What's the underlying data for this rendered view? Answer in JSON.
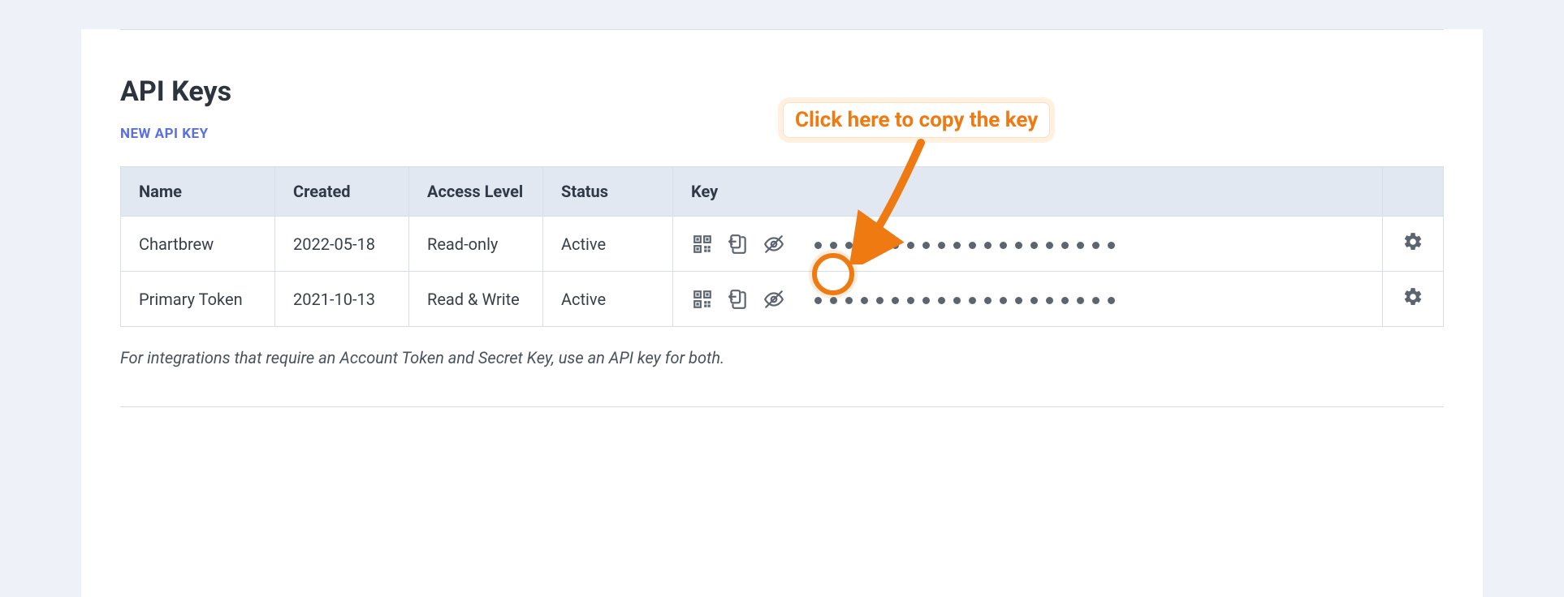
{
  "section": {
    "title": "API Keys",
    "new_key_label": "NEW API KEY",
    "footnote": "For integrations that require an Account Token and Secret Key, use an API key for both."
  },
  "callout": {
    "text": "Click here to copy the key"
  },
  "table": {
    "headers": {
      "name": "Name",
      "created": "Created",
      "access": "Access Level",
      "status": "Status",
      "key": "Key"
    },
    "rows": [
      {
        "name": "Chartbrew",
        "created": "2022-05-18",
        "access": "Read-only",
        "status": "Active",
        "key_masked": "••••••••••••••••••••"
      },
      {
        "name": "Primary Token",
        "created": "2021-10-13",
        "access": "Read & Write",
        "status": "Active",
        "key_masked": "••••••••••••••••••••"
      }
    ]
  }
}
